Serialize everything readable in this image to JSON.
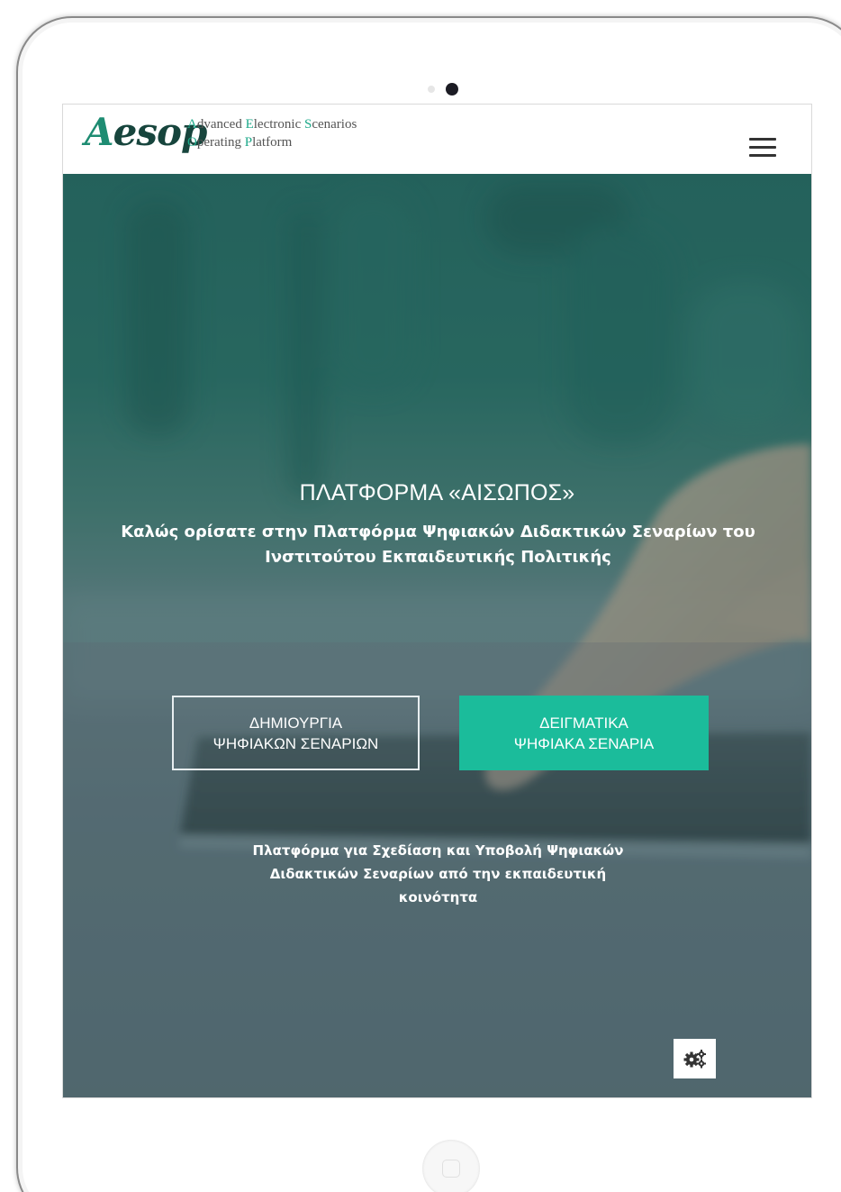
{
  "logo": {
    "mark_first": "A",
    "mark_rest": "esop",
    "tagline": {
      "line1": [
        {
          "text": "A",
          "hl": true
        },
        {
          "text": "dvanced ",
          "hl": false
        },
        {
          "text": "E",
          "hl": true
        },
        {
          "text": "lectronic ",
          "hl": false
        },
        {
          "text": "S",
          "hl": true
        },
        {
          "text": "cenarios",
          "hl": false
        }
      ],
      "line2": [
        {
          "text": "O",
          "hl": true
        },
        {
          "text": "perating ",
          "hl": false
        },
        {
          "text": "P",
          "hl": true
        },
        {
          "text": "latform",
          "hl": false
        }
      ]
    }
  },
  "header": {
    "menu_icon": "hamburger-menu-icon"
  },
  "hero": {
    "title": "ΠΛΑΤΦΟΡΜΑ «ΑΙΣΩΠΟΣ»",
    "subtitle": "Καλώς ορίσατε στην Πλατφόρμα Ψηφιακών Διδακτικών Σεναρίων του Ινστιτούτου Εκπαιδευτικής Πολιτικής",
    "buttons": {
      "create_label": "ΔΗΜΙΟΥΡΓΙΑ\nΨΗΦΙΑΚΩΝ ΣΕΝΑΡΙΩΝ",
      "samples_label": "ΔΕΙΓΜΑΤΙΚΑ\nΨΗΦΙΑΚΑ ΣΕΝΑΡΙΑ"
    },
    "note": "Πλατφόρμα για Σχεδίαση και Υποβολή Ψηφιακών Διδακτικών Σεναρίων από την εκπαιδευτική κοινότητα"
  },
  "settings": {
    "icon": "gears-icon"
  },
  "colors": {
    "accent": "#1bbc9b",
    "logo_dark": "#17453d",
    "hero_top": "#27635d",
    "hero_bottom": "#646d79"
  }
}
